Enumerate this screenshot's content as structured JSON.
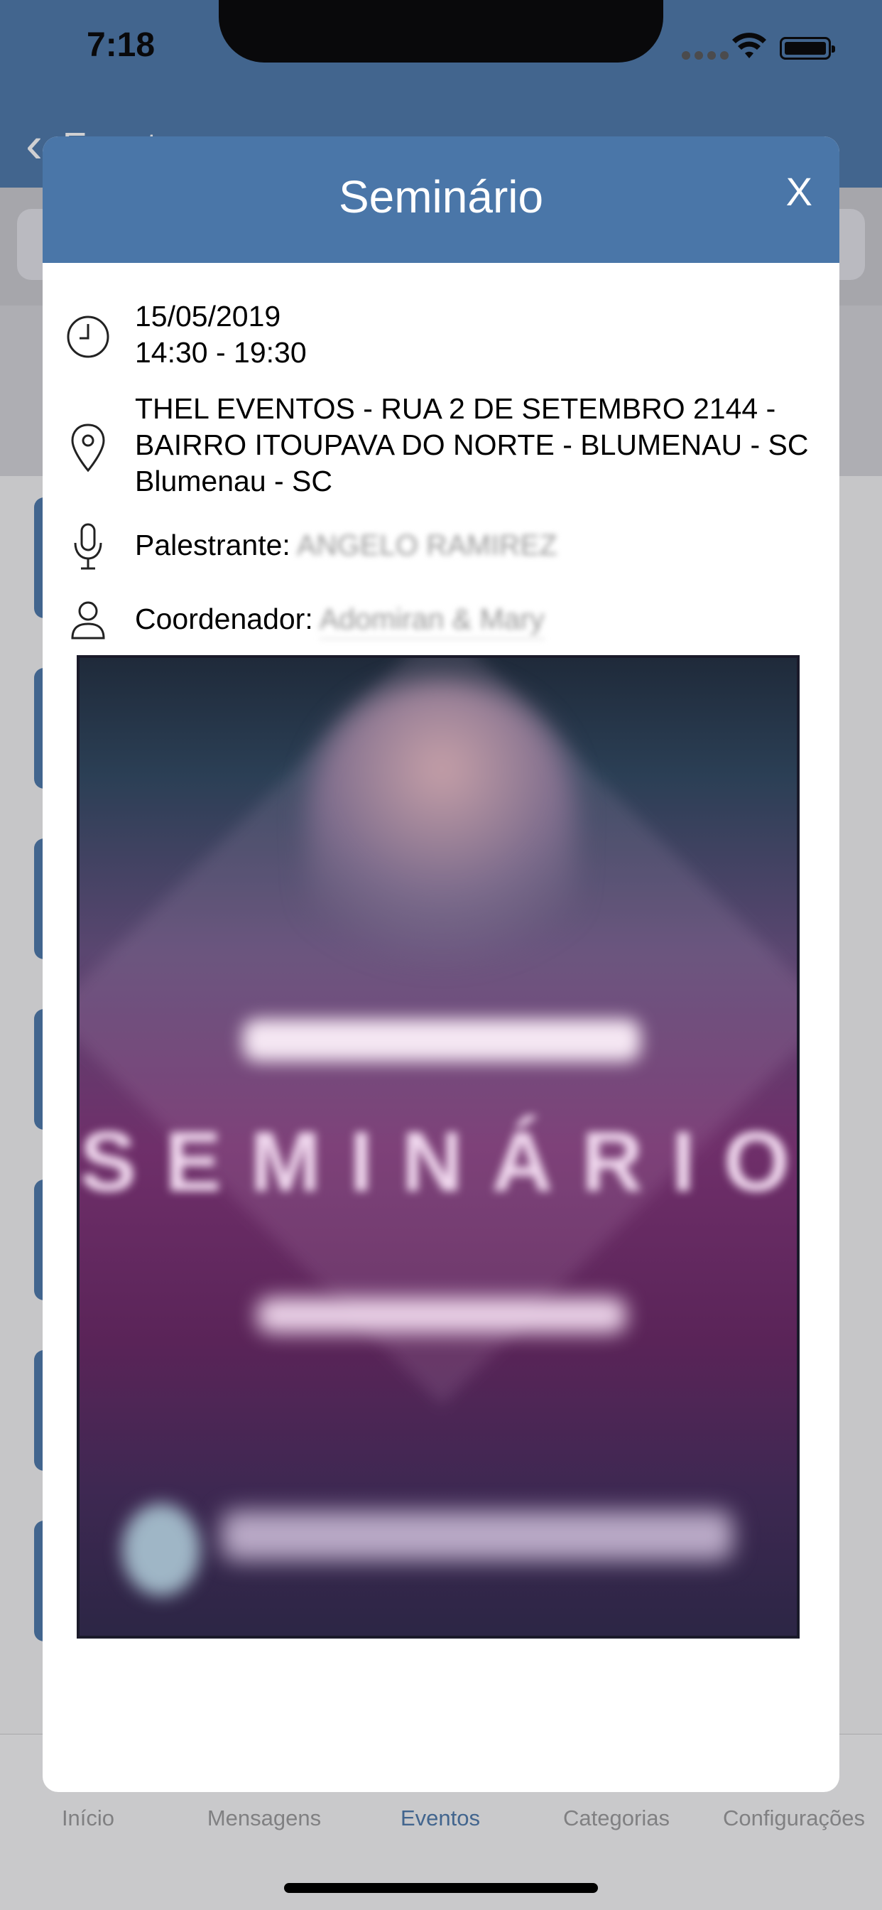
{
  "status": {
    "time": "7:18"
  },
  "nav": {
    "back_label": "Eventos"
  },
  "tabs": [
    {
      "label": "Início",
      "active": false
    },
    {
      "label": "Mensagens",
      "active": false
    },
    {
      "label": "Eventos",
      "active": true
    },
    {
      "label": "Categorias",
      "active": false
    },
    {
      "label": "Configurações",
      "active": false
    }
  ],
  "modal": {
    "title": "Seminário",
    "close_label": "X",
    "date": "15/05/2019",
    "time": "14:30 - 19:30",
    "address_line1": "THEL EVENTOS - RUA 2 DE SETEMBRO 2144 -",
    "address_line2": "BAIRRO ITOUPAVA DO NORTE - BLUMENAU - SC",
    "address_line3": "Blumenau - SC",
    "speaker_label": "Palestrante:",
    "speaker_value": "ANGELO RAMIREZ",
    "coordinator_label": "Coordenador:",
    "coordinator_value": "Adomiran & Mary",
    "poster_text": "SEMINÁRIO"
  },
  "colors": {
    "brand": "#4a76a8",
    "active_tab": "#4a76a8"
  }
}
